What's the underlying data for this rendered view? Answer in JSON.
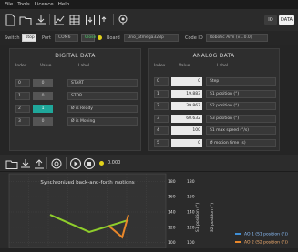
{
  "menu": [
    "File",
    "Tools",
    "Licence",
    "Help"
  ],
  "toolbar": {
    "icons": [
      "new-file-icon",
      "open-folder-icon",
      "save-icon",
      "chart-icon",
      "table-icon",
      "import-icon",
      "export-icon",
      "location-icon"
    ],
    "io_label": "IO",
    "data_label": "DATA"
  },
  "connection": {
    "switch_label": "Switch",
    "switch_value": "stop",
    "port_label": "Port",
    "port_value": "COM6",
    "close_button": "Close",
    "board_label": "Board",
    "board_value": "Uno_atmega328p",
    "code_id_label": "Code ID",
    "code_id_value": "Robotic Arm (v1.0.0)"
  },
  "digital": {
    "title": "DIGITAL DATA",
    "headers": [
      "Index",
      "Value",
      "Label"
    ],
    "rows": [
      {
        "index": "0",
        "value": "0",
        "label": "START"
      },
      {
        "index": "1",
        "value": "0",
        "label": "STOP"
      },
      {
        "index": "2",
        "value": "1",
        "label": "Ø is Ready"
      },
      {
        "index": "3",
        "value": "0",
        "label": "Ø is Moving"
      }
    ]
  },
  "analog": {
    "title": "ANALOG DATA",
    "headers": [
      "Index",
      "Value",
      "Label"
    ],
    "rows": [
      {
        "index": "0",
        "value": "0",
        "label": "Step"
      },
      {
        "index": "1",
        "value": "19.883",
        "label": "S1 position (°)"
      },
      {
        "index": "2",
        "value": "39.867",
        "label": "S2 position (°)"
      },
      {
        "index": "3",
        "value": "60.632",
        "label": "S3 position (°)"
      },
      {
        "index": "4",
        "value": "100",
        "label": "S1 max speed (°/s)"
      },
      {
        "index": "5",
        "value": "0",
        "label": "Ø motion time (s)"
      }
    ]
  },
  "chart_toolbar": {
    "icons": [
      "open-folder-icon",
      "save-icon",
      "export-icon",
      "target-icon",
      "play-icon",
      "stop-icon"
    ],
    "time_value": "0.000"
  },
  "chart_data": {
    "type": "line",
    "title": "Synchronized back-and-forth motions",
    "ytick_labels": [
      "180",
      "160",
      "140",
      "120",
      "100"
    ],
    "ylim": [
      90,
      190
    ],
    "ylabel_right_1": "S1 position (°)",
    "ylabel_right_2": "S2 position (°)",
    "grid": true,
    "legend_position": "bottom-right",
    "series": [
      {
        "name": "AO 1 (S1 position (°))",
        "color": "#3f8fd6"
      },
      {
        "name": "AO 2 (S2 position (°))",
        "color": "#e8872a"
      }
    ],
    "visible_lines": [
      {
        "color": "#8fce2b",
        "points": [
          [
            0.55,
            0.0
          ],
          [
            0.78,
            0.5
          ],
          [
            0.62,
            1.0
          ]
        ]
      },
      {
        "color": "#e8872a",
        "points": [
          [
            0.7,
            0.75
          ],
          [
            0.85,
            0.92
          ],
          [
            0.55,
            1.0
          ]
        ]
      }
    ]
  }
}
